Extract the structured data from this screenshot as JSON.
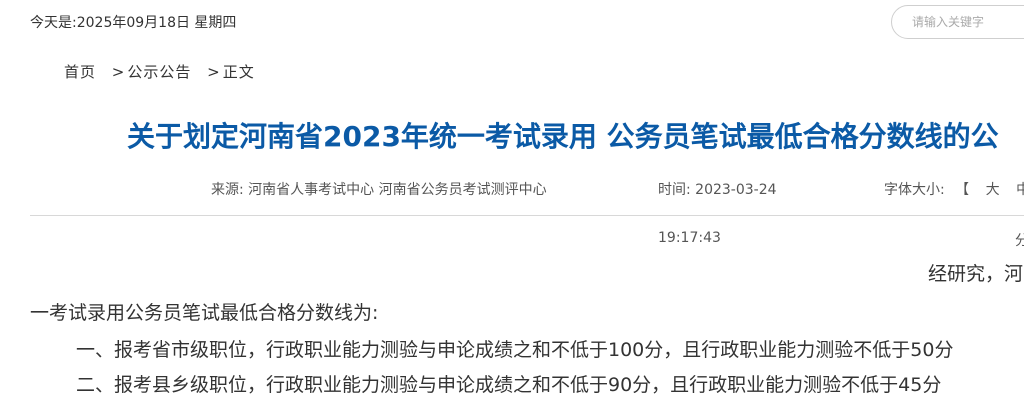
{
  "header": {
    "date_text": "今天是:2025年09月18日 星期四",
    "search_placeholder": "请输入关键字"
  },
  "breadcrumb": {
    "home": "首页",
    "sep1": ">",
    "section": "公示公告",
    "sep2": ">",
    "current": "正文"
  },
  "article": {
    "title": "关于划定河南省2023年统一考试录用 公务员笔试最低合格分数线的公",
    "source_label": "来源:",
    "source_value": "河南省人事考试中心 河南省公务员考试测评中心",
    "time_label": "时间:",
    "time_date": "2023-03-24",
    "time_clock": "19:17:43",
    "font_size_label": "字体大小:",
    "font_size_options": "【 大 中",
    "edge_char": "分",
    "paragraph_intro_tail": "经研究，河",
    "paragraph_intro_cont": "一考试录用公务员笔试最低合格分数线为:",
    "item_1": "一、报考省市级职位，行政职业能力测验与申论成绩之和不低于100分，且行政职业能力测验不低于50分",
    "item_2": "二、报考县乡级职位，行政职业能力测验与申论成绩之和不低于90分，且行政职业能力测验不低于45分"
  }
}
